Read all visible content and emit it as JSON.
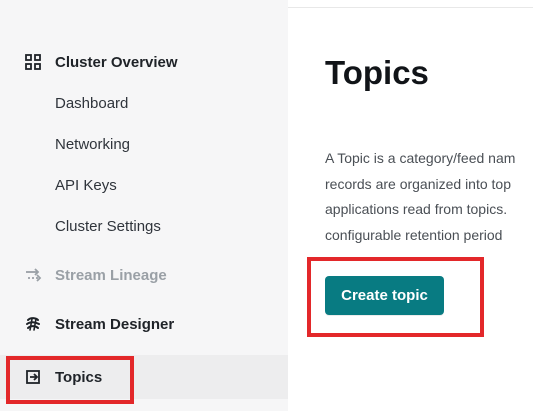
{
  "sidebar": {
    "cluster_overview": {
      "label": "Cluster Overview",
      "icon": "grid-icon",
      "items": [
        {
          "label": "Dashboard"
        },
        {
          "label": "Networking"
        },
        {
          "label": "API Keys"
        },
        {
          "label": "Cluster Settings"
        }
      ]
    },
    "stream_lineage": {
      "label": "Stream Lineage",
      "icon": "stream-lineage-icon",
      "state": "disabled"
    },
    "stream_designer": {
      "label": "Stream Designer",
      "icon": "stream-designer-icon"
    },
    "topics": {
      "label": "Topics",
      "icon": "topics-icon",
      "selected": true
    }
  },
  "main": {
    "title": "Topics",
    "description_lines": [
      "A Topic is a category/feed nam",
      "records are organized into top",
      "applications read from topics.",
      "configurable retention period"
    ],
    "create_button": {
      "label": "Create topic"
    }
  },
  "highlights": {
    "color": "#e3282a"
  },
  "colors": {
    "accent": "#087b82",
    "sidebar_background": "#f6f6f7",
    "selected_background": "#ededee",
    "disabled_text": "#9aa0a6"
  }
}
